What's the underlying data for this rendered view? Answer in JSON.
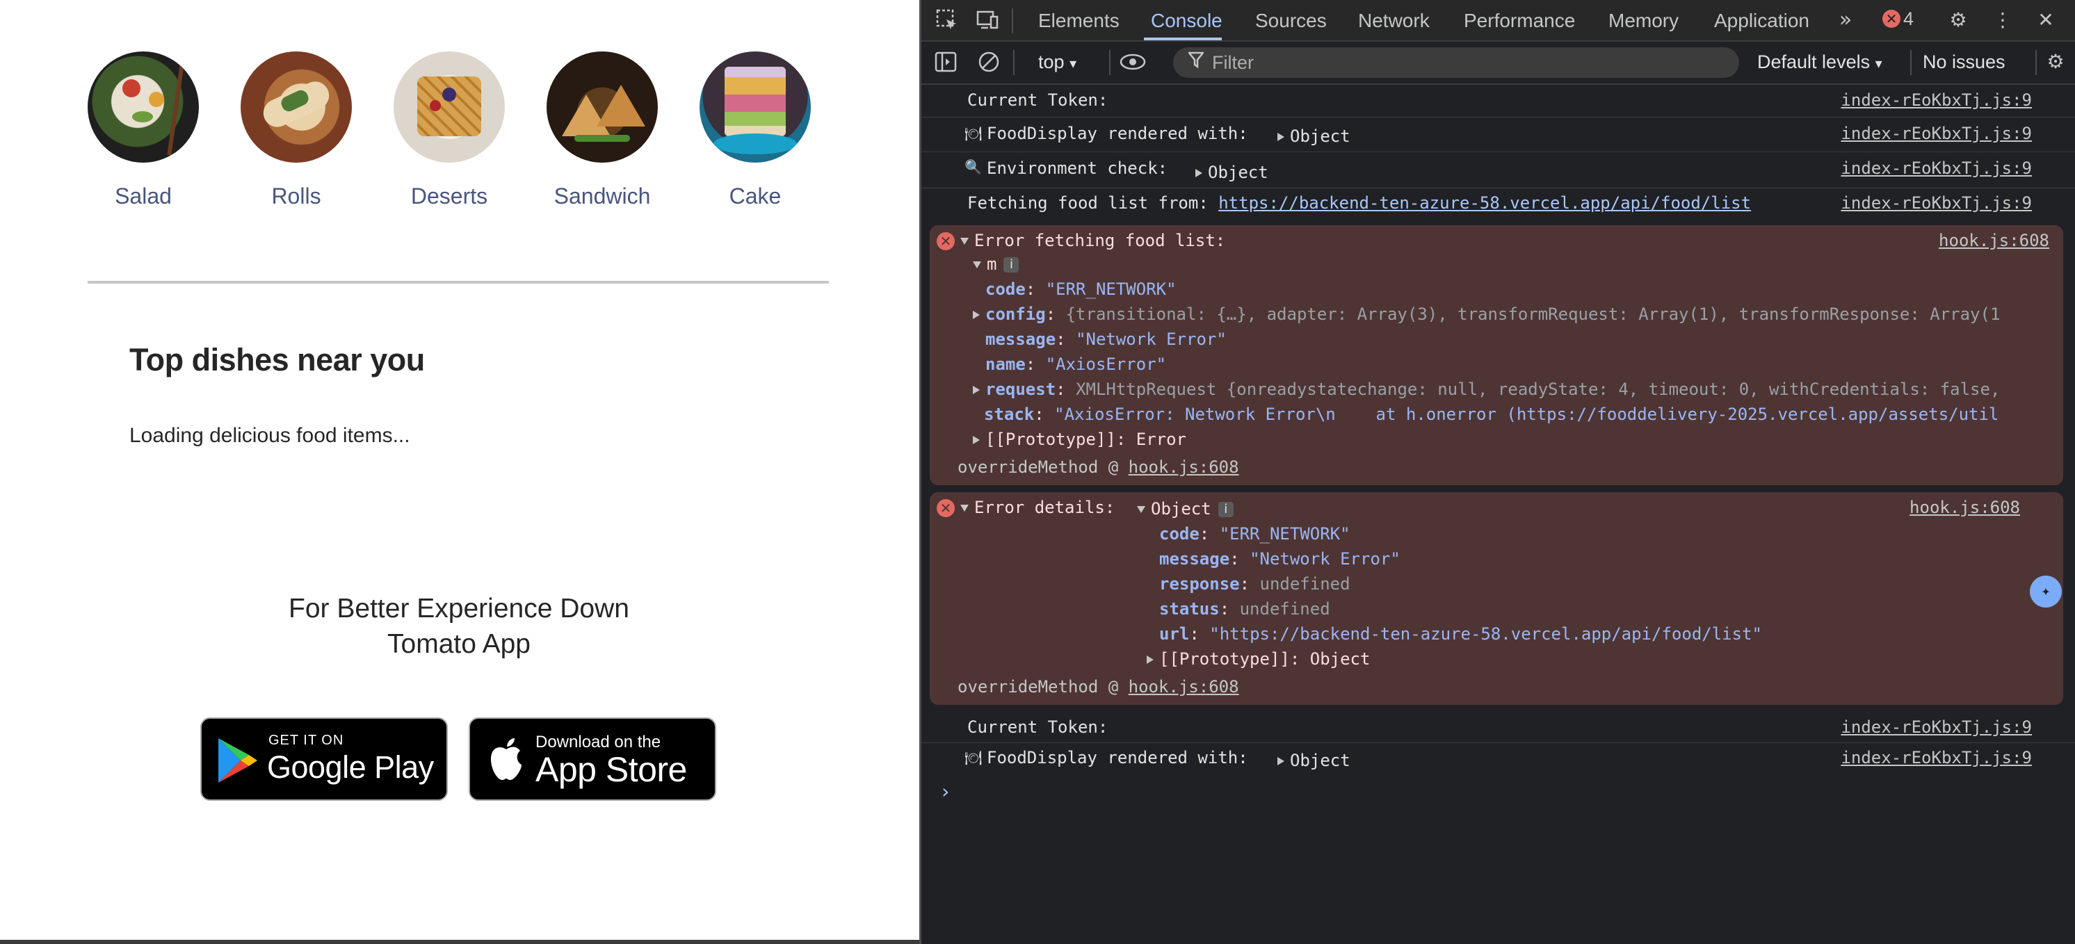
{
  "page": {
    "categories": [
      {
        "label": "Salad"
      },
      {
        "label": "Rolls"
      },
      {
        "label": "Deserts"
      },
      {
        "label": "Sandwich"
      },
      {
        "label": "Cake"
      }
    ],
    "top_dishes_title": "Top dishes near you",
    "loading_text": "Loading delicious food items...",
    "app_title_line1": "For Better Experience Down",
    "app_title_line2": "Tomato App",
    "google_play": {
      "small": "GET IT ON",
      "big": "Google Play"
    },
    "app_store": {
      "small": "Download on the",
      "big": "App Store"
    }
  },
  "devtools": {
    "tabs": [
      "Elements",
      "Console",
      "Sources",
      "Network",
      "Performance",
      "Memory",
      "Application"
    ],
    "active_tab": "Console",
    "error_count": "4",
    "context": "top",
    "filter_placeholder": "Filter",
    "levels": "Default levels",
    "issues": "No issues",
    "console": {
      "l1_msg": "Current Token:",
      "l1_src": "index-rEoKbxTj.js:9",
      "l2_msg": "FoodDisplay rendered with:",
      "l2_obj": "Object",
      "l2_src": "index-rEoKbxTj.js:9",
      "l3_msg": "Environment check:",
      "l3_obj": "Object",
      "l3_src": "index-rEoKbxTj.js:9",
      "l4_msg": "Fetching food list from: ",
      "l4_url": "https://backend-ten-azure-58.vercel.app/api/food/list",
      "l4_src": "index-rEoKbxTj.js:9",
      "e1_title": "Error fetching food list:",
      "e1_src": "hook.js:608",
      "e1_obj": "m",
      "e1_code_key": "code",
      "e1_code_val": "\"ERR_NETWORK\"",
      "e1_config_key": "config",
      "e1_config_val": "{transitional: {…}, adapter: Array(3), transformRequest: Array(1), transformResponse: Array(1",
      "e1_message_key": "message",
      "e1_message_val": "\"Network Error\"",
      "e1_name_key": "name",
      "e1_name_val": "\"AxiosError\"",
      "e1_request_key": "request",
      "e1_request_val": "XMLHttpRequest {onreadystatechange: null, readyState: 4, timeout: 0, withCredentials: false,",
      "e1_stack_key": "stack",
      "e1_stack_val": "\"AxiosError: Network Error\\n    at h.onerror (https://fooddelivery-2025.vercel.app/assets/util",
      "e1_proto": "[[Prototype]]: Error",
      "e1_override": "overrideMethod @ ",
      "e1_override_src": "hook.js:608",
      "e2_title": "Error details:",
      "e2_obj": "Object",
      "e2_src": "hook.js:608",
      "e2_code_key": "code",
      "e2_code_val": "\"ERR_NETWORK\"",
      "e2_message_key": "message",
      "e2_message_val": "\"Network Error\"",
      "e2_response_key": "response",
      "e2_response_val": "undefined",
      "e2_status_key": "status",
      "e2_status_val": "undefined",
      "e2_url_key": "url",
      "e2_url_val": "\"https://backend-ten-azure-58.vercel.app/api/food/list\"",
      "e2_proto": "[[Prototype]]: Object",
      "e2_override": "overrideMethod @ ",
      "e2_override_src": "hook.js:608",
      "l5_msg": "Current Token:",
      "l5_src": "index-rEoKbxTj.js:9",
      "l6_msg": "FoodDisplay rendered with:",
      "l6_obj": "Object",
      "l6_src": "index-rEoKbxTj.js:9"
    }
  },
  "colors": {
    "page_text": "#49557e",
    "devtools_bg": "#202124",
    "error_bg": "#4e3534",
    "accent": "#a8c7fa"
  }
}
